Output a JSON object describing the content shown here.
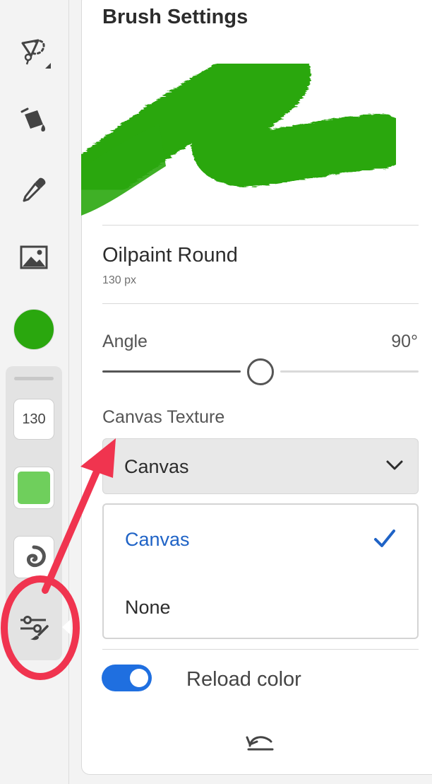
{
  "toolbar": {
    "tools": [
      {
        "name": "lasso-selection-icon"
      },
      {
        "name": "paint-bucket-icon"
      },
      {
        "name": "eyedropper-icon"
      },
      {
        "name": "image-icon"
      }
    ],
    "color": "#2aa70e",
    "brush_size_value": "130",
    "opacity_color": "#6fcf5c",
    "settings_icon": "brush-settings-icon"
  },
  "panel": {
    "title": "Brush Settings",
    "brush_name": "Oilpaint Round",
    "brush_size": "130 px",
    "angle_label": "Angle",
    "angle_value": "90°",
    "angle_fraction": 0.5,
    "texture_label": "Canvas Texture",
    "texture_selected": "Canvas",
    "texture_options": [
      {
        "label": "Canvas",
        "selected": true
      },
      {
        "label": "None",
        "selected": false
      }
    ],
    "reload_color_label": "Reload color",
    "reload_color_on": true,
    "accent_color": "#1f63c6",
    "stroke_color": "#2aa70e"
  },
  "annotation": {
    "color": "#f0344f"
  }
}
